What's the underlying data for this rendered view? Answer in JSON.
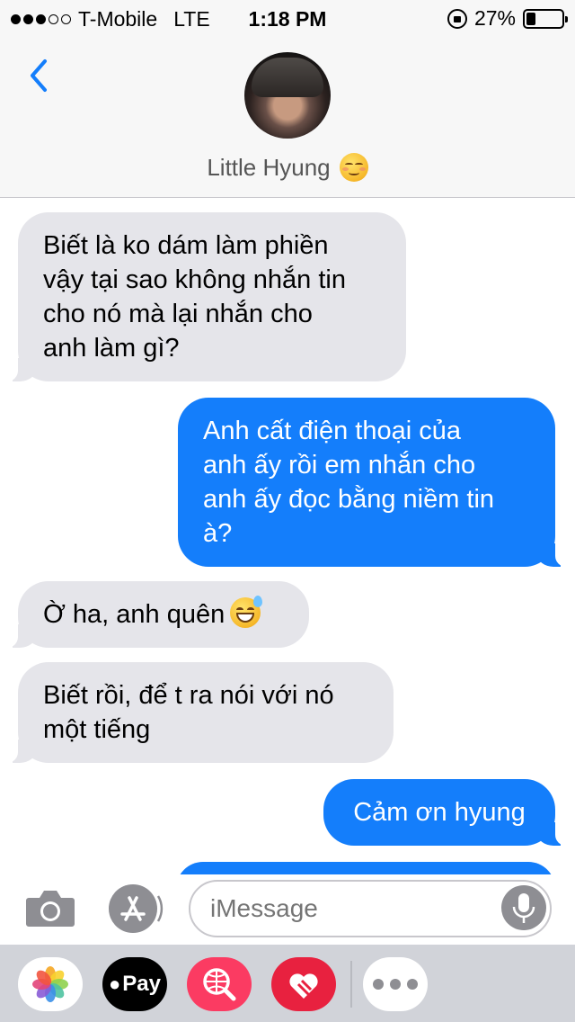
{
  "status_bar": {
    "carrier": "T-Mobile",
    "network": "LTE",
    "time": "1:18 PM",
    "battery": "27%",
    "battery_level": 0.27,
    "signal_bars": 3,
    "signal_total": 5
  },
  "header": {
    "contact_name": "Little Hyung",
    "name_emoji": "relieved-face-icon",
    "back_icon": "chevron-left-icon",
    "accent_color": "#147efb"
  },
  "messages": [
    {
      "direction": "incoming",
      "text": "Biết là ko dám làm phiền\nvậy tại sao không nhắn tin\ncho nó mà lại nhắn cho\nanh làm gì?"
    },
    {
      "direction": "outgoing",
      "text": "Anh cất điện thoại của\nanh ấy rồi em nhắn cho\nanh ấy đọc bằng niềm tin\nà?"
    },
    {
      "direction": "incoming",
      "text": "Ờ ha, anh quên",
      "emoji": "grinning-sweat-face-icon"
    },
    {
      "direction": "incoming",
      "text": "Biết rồi, để t ra nói với nó\nmột tiếng"
    },
    {
      "direction": "outgoing",
      "text": "Cảm ơn hyung"
    },
    {
      "direction": "outgoing",
      "text": ""
    }
  ],
  "input_bar": {
    "placeholder": "iMessage",
    "camera_icon": "camera-icon",
    "apps_icon": "app-store-icon",
    "mic_icon": "microphone-icon"
  },
  "app_drawer": {
    "apps": [
      {
        "name": "photos-icon"
      },
      {
        "name": "apple-pay-icon",
        "label": "Pay"
      },
      {
        "name": "image-search-icon"
      },
      {
        "name": "digital-touch-icon"
      },
      {
        "name": "more-apps-icon"
      }
    ]
  },
  "colors": {
    "incoming_bubble": "#e5e5ea",
    "outgoing_bubble": "#147efb",
    "header_bg": "#f7f7f7",
    "drawer_bg": "#d1d3d9"
  }
}
